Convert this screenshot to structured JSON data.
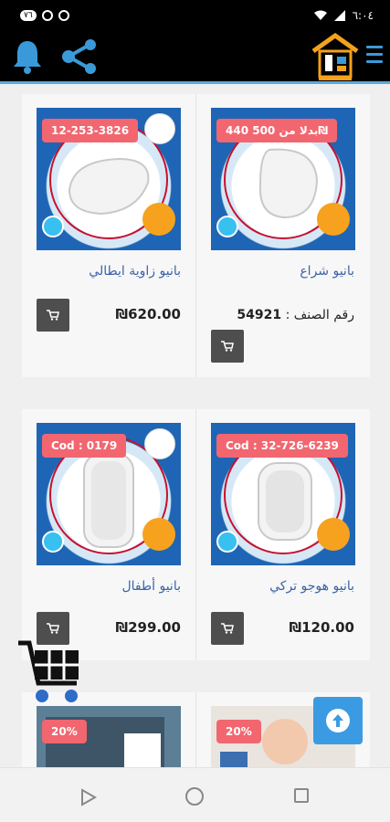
{
  "status_bar": {
    "time": "٦:٠٤",
    "battery": "٧٦"
  },
  "products": [
    {
      "title": "بانيو شراع",
      "badge": "440 بدلا من 500₪",
      "code_label": "رقم الصنف :",
      "code_value": "54921"
    },
    {
      "title": "بانيو زاوية ايطالي",
      "badge": "12-253-3826",
      "price": "₪620.00"
    },
    {
      "title": "بانيو هوجو تركي",
      "badge": "Cod : 32-726-6239",
      "price": "₪120.00"
    },
    {
      "title": "بانيو أطفال",
      "badge": "Cod : 0179",
      "price": "₪299.00"
    },
    {
      "badge": "20%"
    },
    {
      "badge": "20%"
    }
  ],
  "colors": {
    "accent": "#3a9ad9",
    "badge": "#f26670",
    "title": "#3b63a8"
  }
}
